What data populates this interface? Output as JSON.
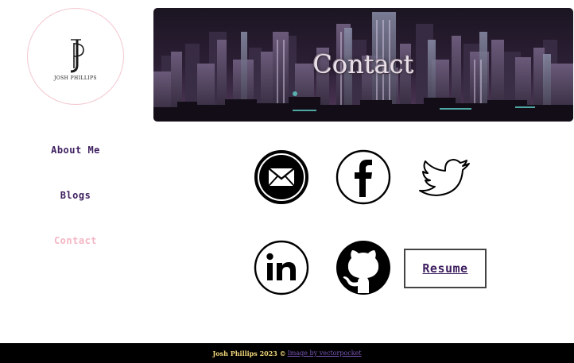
{
  "logo": {
    "text": "JOSH PHILLIPS"
  },
  "banner": {
    "title": "Contact"
  },
  "nav": {
    "items": [
      {
        "label": "About Me",
        "active": false
      },
      {
        "label": "Blogs",
        "active": false
      },
      {
        "label": "Contact",
        "active": true
      }
    ]
  },
  "social": {
    "icons": [
      "email-icon",
      "facebook-icon",
      "twitter-icon",
      "linkedin-icon",
      "github-icon"
    ]
  },
  "resume": {
    "label": "Resume"
  },
  "footer": {
    "name": "Josh Phillips 2023 ©",
    "credit": "Image by vectorpocket"
  },
  "colors": {
    "nav_text": "#3d1e5f",
    "nav_active": "#f4b6c3",
    "footer_bg": "#000000",
    "footer_name": "#f1d77a",
    "footer_credit": "#7a57b8"
  }
}
